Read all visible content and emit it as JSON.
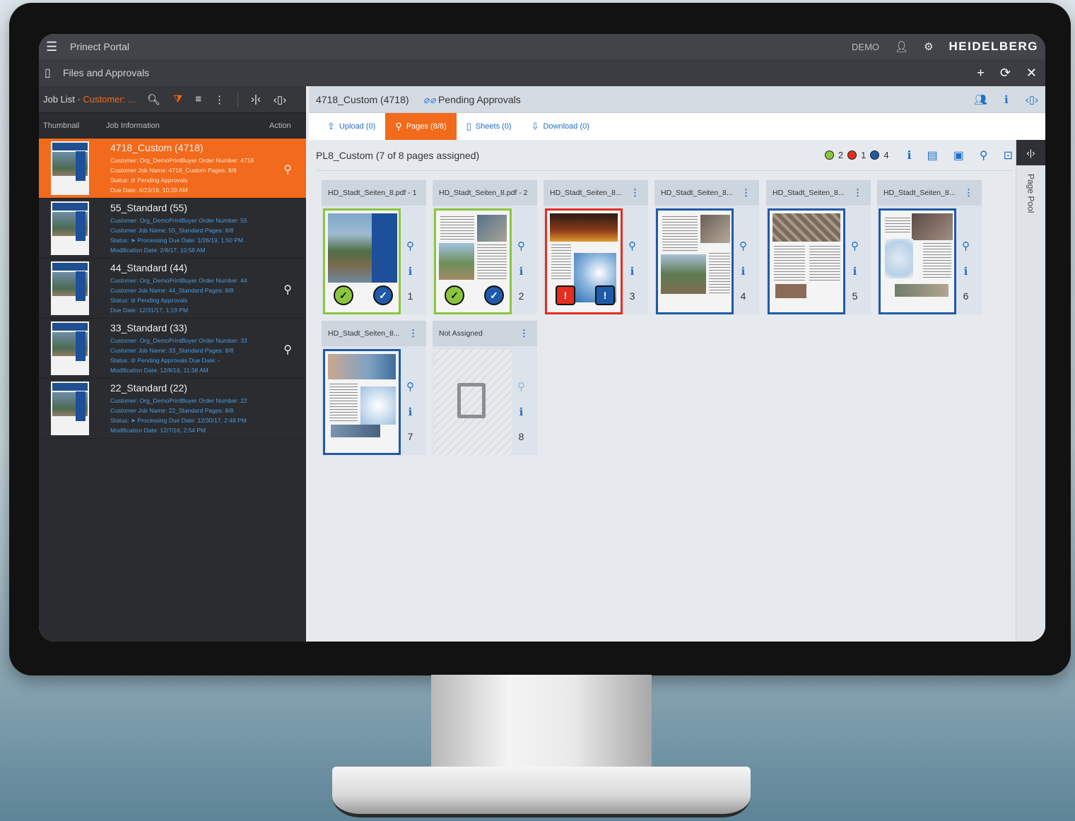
{
  "topbar": {
    "app_title": "Prinect Portal",
    "demo_label": "DEMO",
    "brand": "HEIDELBERG"
  },
  "subbar": {
    "title": "Files and Approvals"
  },
  "left": {
    "toolbar": {
      "label": "Job List · ",
      "customer": "Customer: ..."
    },
    "headers": {
      "thumbnail": "Thumbnail",
      "job_information": "Job Information",
      "action": "Action"
    },
    "jobs": [
      {
        "title": "4718_Custom (4718)",
        "line1": "Customer: Org_DemoPrintBuyer  Order Number: 4718",
        "line2": "Customer Job Name: 4718_Custom  Pages: 8/8",
        "line3": "Status: ⊘ Pending Approvals",
        "line4": "Due Date: 6/23/18, 10:20 AM"
      },
      {
        "title": "55_Standard (55)",
        "line1": "Customer: Org_DemoPrintBuyer  Order Number: 55",
        "line2": "Customer Job Name: 55_Standard  Pages: 8/8",
        "line3": "Status: ➤ Processing  Due Date: 1/26/19, 1:50 PM",
        "line4": "Modification Date: 2/8/17, 10:58 AM"
      },
      {
        "title": "44_Standard (44)",
        "line1": "Customer: Org_DemoPrintBuyer  Order Number: 44",
        "line2": "Customer Job Name: 44_Standard  Pages: 8/8",
        "line3": "Status: ⊘ Pending Approvals",
        "line4": "Due Date: 12/31/17, 1:19 PM"
      },
      {
        "title": "33_Standard (33)",
        "line1": "Customer: Org_DemoPrintBuyer  Order Number: 33",
        "line2": "Customer Job Name: 33_Standard  Pages: 8/8",
        "line3": "Status: ⊘ Pending Approvals  Due Date: -",
        "line4": "Modification Date: 12/8/16, 11:38 AM"
      },
      {
        "title": "22_Standard (22)",
        "line1": "Customer: Org_DemoPrintBuyer  Order Number: 22",
        "line2": "Customer Job Name: 22_Standard  Pages: 8/8",
        "line3": "Status: ➤ Processing  Due Date: 12/30/17, 2:48 PM",
        "line4": "Modification Date: 12/7/16, 2:54 PM"
      }
    ]
  },
  "right": {
    "header": {
      "job": "4718_Custom (4718)",
      "status": "Pending Approvals"
    },
    "tabs": [
      "Upload (0)",
      "Pages (8/8)",
      "Sheets (0)",
      "Download (0)"
    ],
    "content_title": "PL8_Custom (7 of 8 pages assigned)",
    "legend": {
      "green_count": "2",
      "red_count": "1",
      "blue_count": "4"
    },
    "page_pool_label": "Page Pool",
    "pages": [
      {
        "title": "HD_Stadt_Seiten_8.pdf - 1",
        "number": "1"
      },
      {
        "title": "HD_Stadt_Seiten_8.pdf - 2",
        "number": "2"
      },
      {
        "title": "HD_Stadt_Seiten_8...",
        "number": "3"
      },
      {
        "title": "HD_Stadt_Seiten_8...",
        "number": "4"
      },
      {
        "title": "HD_Stadt_Seiten_8...",
        "number": "5"
      },
      {
        "title": "HD_Stadt_Seiten_8...",
        "number": "6"
      },
      {
        "title": "HD_Stadt_Seiten_8...",
        "number": "7"
      },
      {
        "title": "Not Assigned",
        "number": "8"
      }
    ]
  }
}
